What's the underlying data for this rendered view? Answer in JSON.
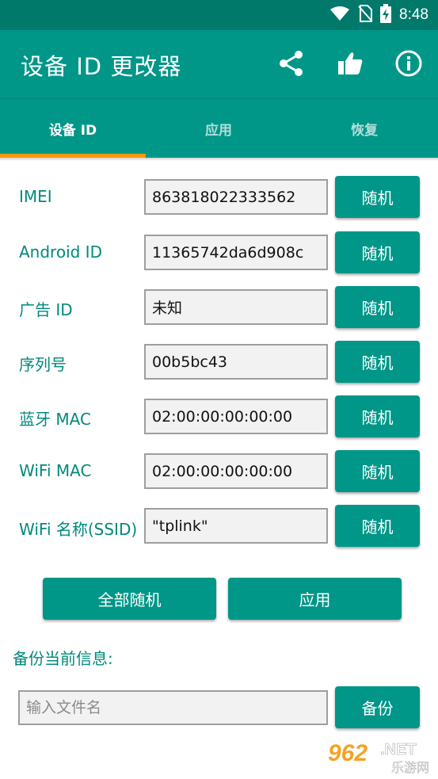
{
  "status_bar": {
    "time": "8:48"
  },
  "app_bar": {
    "title": "设备 ID 更改器",
    "icons": [
      "share-icon",
      "thumbs-up-icon",
      "info-icon"
    ]
  },
  "tabs": [
    {
      "label": "设备 ID",
      "active": true
    },
    {
      "label": "应用",
      "active": false
    },
    {
      "label": "恢复",
      "active": false
    }
  ],
  "rows": [
    {
      "label": "IMEI",
      "value": "863818022333562",
      "button": "随机"
    },
    {
      "label": "Android ID",
      "value": "11365742da6d908c",
      "button": "随机"
    },
    {
      "label": "广告 ID",
      "value": "未知",
      "button": "随机"
    },
    {
      "label": "序列号",
      "value": "00b5bc43",
      "button": "随机"
    },
    {
      "label": "蓝牙 MAC",
      "value": "02:00:00:00:00:00",
      "button": "随机"
    },
    {
      "label": "WiFi MAC",
      "value": "02:00:00:00:00:00",
      "button": "随机"
    },
    {
      "label": "WiFi 名称(SSID)",
      "value": "\"tplink\"",
      "button": "随机"
    }
  ],
  "actions": {
    "random_all": "全部随机",
    "apply": "应用"
  },
  "backup": {
    "label": "备份当前信息:",
    "placeholder": "输入文件名",
    "button": "备份"
  },
  "watermark": {
    "number": "962",
    "suffix": ".NET",
    "site": "乐游网"
  },
  "colors": {
    "primary": "#009688",
    "primary_dark": "#00796b",
    "accent": "#ff9800",
    "label_text": "#00897b"
  }
}
